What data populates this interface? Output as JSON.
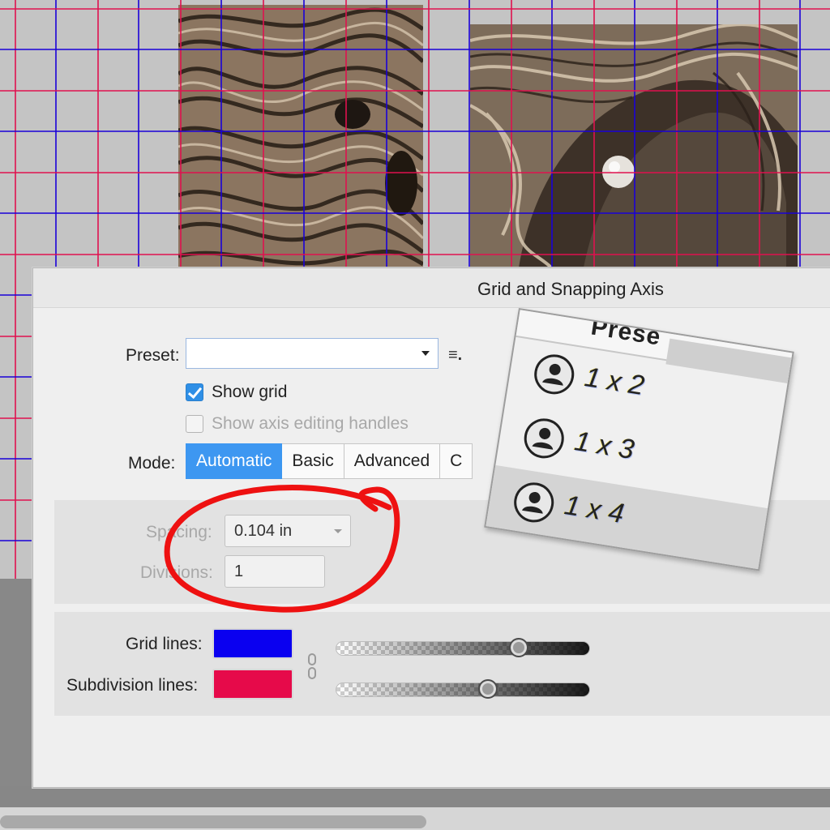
{
  "dialog": {
    "title": "Grid and Snapping Axis",
    "preset_label": "Preset:",
    "preset_value": "",
    "show_grid_label": "Show grid",
    "show_grid_checked": true,
    "show_axis_label": "Show axis editing handles",
    "show_axis_checked": false,
    "mode_label": "Mode:",
    "mode_tabs": [
      "Automatic",
      "Basic",
      "Advanced",
      "C"
    ],
    "active_mode": "Automatic",
    "spacing_label": "Spacing:",
    "spacing_value": "0.104 in",
    "divisions_label": "Divisions:",
    "divisions_value": "1",
    "grid_lines_label": "Grid lines:",
    "subdivision_lines_label": "Subdivision lines:",
    "grid_lines_color": "#0a00f0",
    "subdivision_lines_color": "#e60a4a",
    "grid_lines_opacity": 0.72,
    "subdivision_lines_opacity": 0.6
  },
  "preset_popup": {
    "header_partial": "Prese",
    "items": [
      "1 x 2",
      "1 x 3",
      "1 x 4"
    ],
    "selected": "1 x 4"
  },
  "colors": {
    "grid_blue": "#1a00d8",
    "subdivision_red": "#e0114f",
    "accent": "#3d97f1",
    "annotation": "#ee1111"
  },
  "icons": [
    "menu-icon",
    "checkmark-icon",
    "link-chain-icon",
    "person-circle-icon",
    "dropdown-caret-icon"
  ]
}
